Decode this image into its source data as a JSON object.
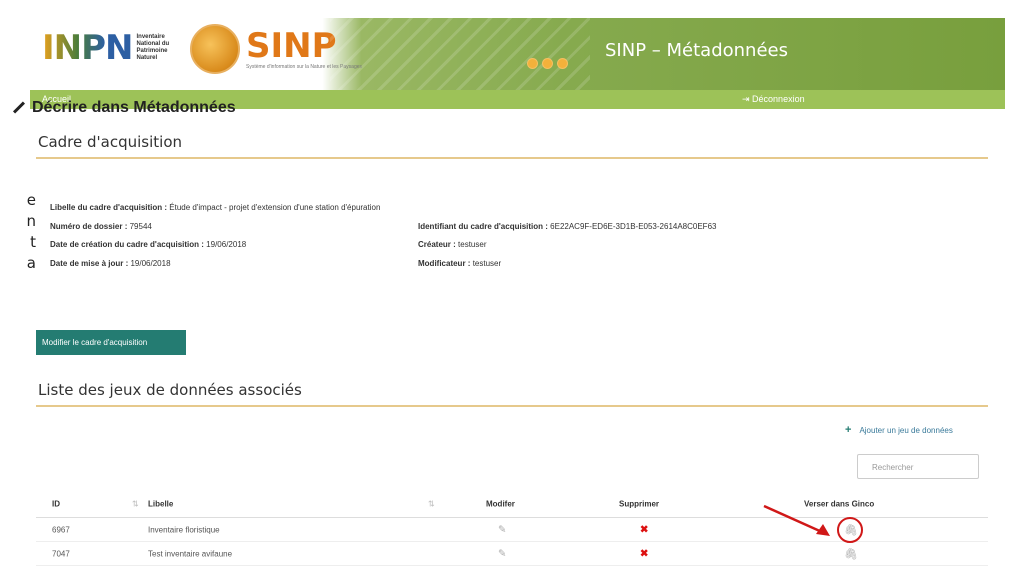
{
  "clipped_text": [
    "e",
    "n",
    "t",
    "a"
  ],
  "header": {
    "inpn_logo": "INPN",
    "inpn_subtitle": "Inventaire National du Patrimoine Naturel",
    "sinp_logo": "SINP",
    "sinp_subtitle": "Système d'information sur la Nature et les Paysages",
    "app_title": "SINP – Métadonnées"
  },
  "nav": {
    "home": "Accueil",
    "logout": "⇥ Déconnexion"
  },
  "page": {
    "title": "Décrire dans Métadonnées",
    "section1": "Cadre d'acquisition",
    "section2": "Liste des jeux de données associés"
  },
  "acquisition": {
    "libelle_label": "Libelle du cadre d'acquisition :",
    "libelle_value": "Étude d'impact - projet d'extension d'une station d'épuration",
    "dossier_label": "Numéro de dossier :",
    "dossier_value": "79544",
    "creation_label": "Date de création du cadre d'acquisition :",
    "creation_value": "19/06/2018",
    "maj_label": "Date de mise à jour :",
    "maj_value": "19/06/2018",
    "id_label": "Identifiant du cadre d'acquisition :",
    "id_value": "6E22AC9F-ED6E-3D1B-E053-2614A8C0EF63",
    "createur_label": "Créateur :",
    "createur_value": "testuser",
    "modificateur_label": "Modificateur :",
    "modificateur_value": "testuser"
  },
  "actions": {
    "modify_label": "Modifier le cadre d'acquisition",
    "add_dataset_label": "Ajouter un jeu de données",
    "search_placeholder": "Rechercher"
  },
  "table": {
    "headers": {
      "id": "ID",
      "libelle": "Libelle",
      "modifier": "Modifer",
      "supprimer": "Supprimer",
      "verser": "Verser dans Ginco"
    },
    "rows": [
      {
        "id": "6967",
        "libelle": "Inventaire floristique"
      },
      {
        "id": "7047",
        "libelle": "Test inventaire avifaune"
      }
    ]
  },
  "colors": {
    "banner_green": "#86aa4e",
    "nav_green": "#9dc258",
    "button_teal": "#247c72",
    "rule_gold": "#e6c98c",
    "highlight_red": "#d01818"
  },
  "icons": {
    "edit": "edit-icon",
    "delete": "delete-x-icon",
    "attach": "paperclip-icon",
    "pencil": "pencil-icon",
    "plus": "plus-icon"
  }
}
